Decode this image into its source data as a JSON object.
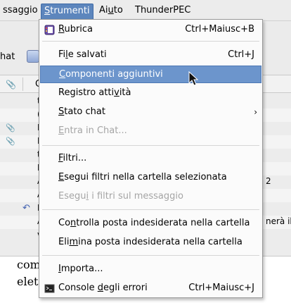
{
  "menubar": {
    "items": [
      {
        "pre": "",
        "u": "",
        "post": "ssaggio"
      },
      {
        "pre": "",
        "u": "S",
        "post": "trumenti"
      },
      {
        "pre": "Ai",
        "u": "u",
        "post": "to"
      },
      {
        "pre": "",
        "u": "",
        "post": "ThunderPEC"
      }
    ]
  },
  "background": {
    "chat_label": "hat",
    "list_header_col": "C",
    "rows": [
      {
        "clip": false,
        "text": "t",
        "right": ""
      },
      {
        "clip": false,
        "text": "(",
        "right": ""
      },
      {
        "clip": true,
        "text": "I",
        "right": ""
      },
      {
        "clip": true,
        "text": "I",
        "right": ""
      },
      {
        "clip": false,
        "text": "t",
        "right": ""
      },
      {
        "clip": false,
        "text": "I",
        "right": ""
      },
      {
        "clip": false,
        "text": "A",
        "right": "2"
      },
      {
        "clip": false,
        "text": "A",
        "right": ""
      },
      {
        "clip": false,
        "text": "I",
        "right": ""
      },
      {
        "clip": false,
        "text": "A",
        "right": "nerà il"
      },
      {
        "clip": false,
        "text": "v",
        "right": ""
      }
    ],
    "preview_lines": [
      "com",
      "elet"
    ]
  },
  "menu": {
    "items": [
      {
        "pre": "",
        "u": "R",
        "post": "ubrica",
        "accel": "Ctrl+Maiusc+B",
        "icon": "address-book-icon",
        "state": "normal",
        "arrow": false
      },
      {
        "pre": "Fi",
        "u": "l",
        "post": "e salvati",
        "accel": "Ctrl+J",
        "icon": "",
        "state": "normal",
        "arrow": false
      },
      {
        "pre": "",
        "u": "C",
        "post": "omponenti aggiuntivi",
        "accel": "",
        "icon": "",
        "state": "highlight",
        "arrow": false
      },
      {
        "pre": "Registro atti",
        "u": "v",
        "post": "ità",
        "accel": "",
        "icon": "",
        "state": "normal",
        "arrow": false
      },
      {
        "pre": "",
        "u": "S",
        "post": "tato chat",
        "accel": "",
        "icon": "",
        "state": "normal",
        "arrow": true
      },
      {
        "pre": "",
        "u": "E",
        "post": "ntra in Chat...",
        "accel": "",
        "icon": "",
        "state": "disabled",
        "arrow": false
      },
      {
        "pre": "",
        "u": "F",
        "post": "iltri...",
        "accel": "",
        "icon": "",
        "state": "normal",
        "arrow": false
      },
      {
        "pre": "",
        "u": "E",
        "post": "segui filtri nella cartella selezionata",
        "accel": "",
        "icon": "",
        "state": "normal",
        "arrow": false
      },
      {
        "pre": "Esegu",
        "u": "i",
        "post": " i filtri sul messaggio",
        "accel": "",
        "icon": "",
        "state": "disabled",
        "arrow": false
      },
      {
        "pre": "Co",
        "u": "n",
        "post": "trolla posta indesiderata nella cartella",
        "accel": "",
        "icon": "",
        "state": "normal",
        "arrow": false
      },
      {
        "pre": "Eli",
        "u": "m",
        "post": "ina posta indesiderata nella cartella",
        "accel": "",
        "icon": "",
        "state": "normal",
        "arrow": false
      },
      {
        "pre": "",
        "u": "I",
        "post": "mporta...",
        "accel": "",
        "icon": "",
        "state": "normal",
        "arrow": false
      },
      {
        "pre": "Console ",
        "u": "d",
        "post": "egli errori",
        "accel": "Ctrl+Maiusc+J",
        "icon": "console-icon",
        "state": "normal",
        "arrow": false
      }
    ]
  },
  "colors": {
    "highlight": "#6c95cc",
    "menubar_open": "#5d86bd",
    "disabled_text": "#a5a5a5"
  }
}
